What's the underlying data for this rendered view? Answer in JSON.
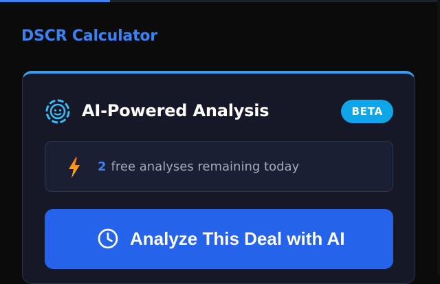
{
  "top_progress": {
    "fraction": 0.25
  },
  "page": {
    "title": "DSCR Calculator"
  },
  "ai_card": {
    "title": "AI-Powered Analysis",
    "badge": "BETA",
    "header_icon": "brain-icon",
    "accent_color": "#3b9ff0",
    "usage": {
      "icon": "lightning-bolt-icon",
      "count": "2",
      "text": "free analyses remaining today"
    },
    "analyze_button": {
      "icon": "clock-icon",
      "label": "Analyze This Deal with AI",
      "color": "#2563eb"
    }
  }
}
